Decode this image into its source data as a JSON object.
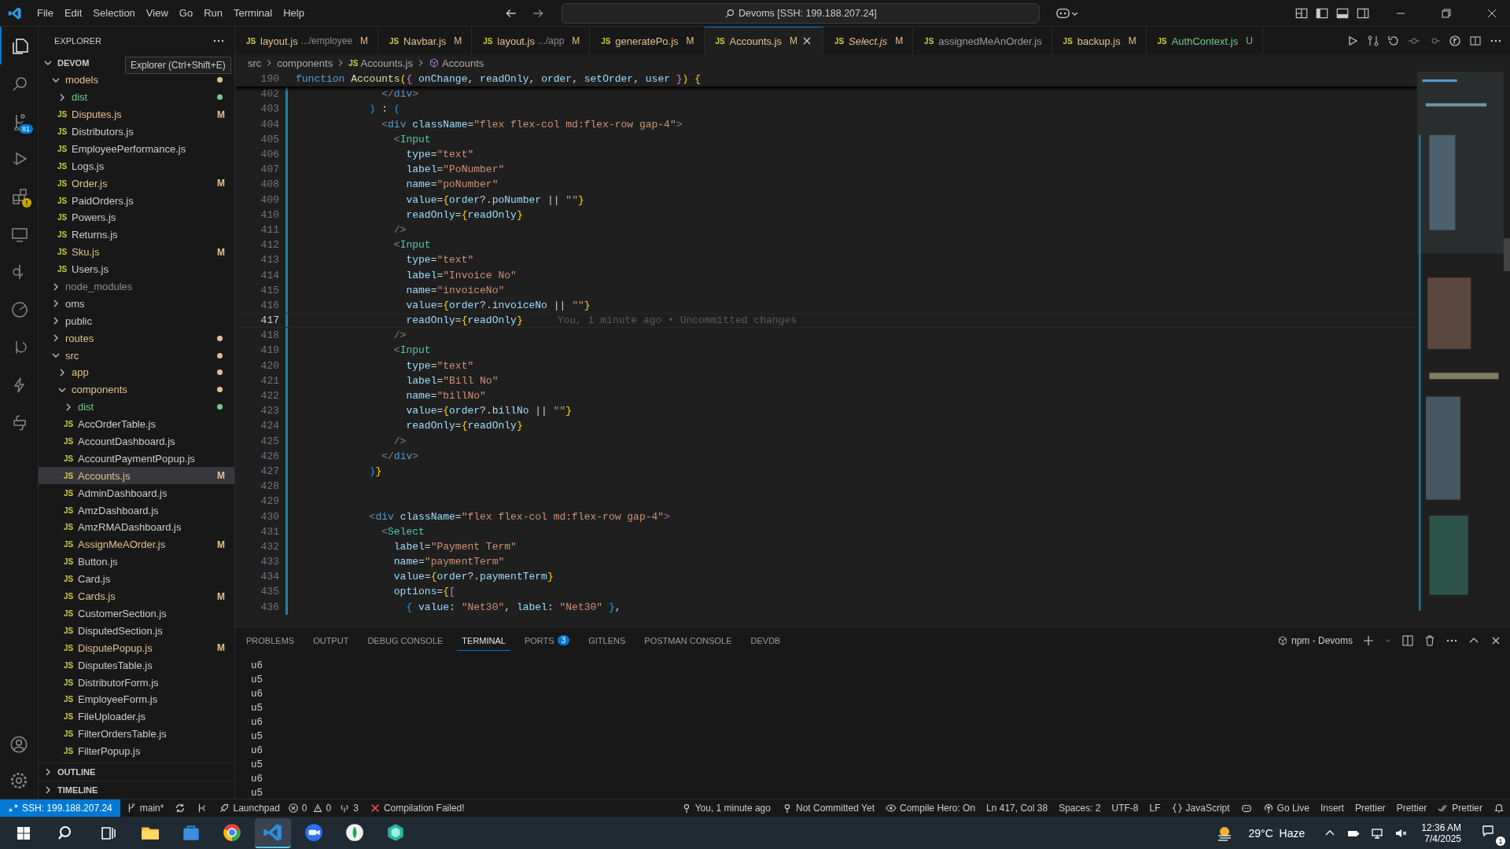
{
  "title_bar": {
    "menu": [
      "File",
      "Edit",
      "Selection",
      "View",
      "Go",
      "Run",
      "Terminal",
      "Help"
    ],
    "command_center": "Devoms [SSH: 199.188.207.24]"
  },
  "activity_bar": {
    "items": [
      {
        "selected": true
      },
      {
        "selected": false
      },
      {
        "selected": false,
        "badge": "81"
      },
      {
        "selected": false
      },
      {
        "selected": false,
        "warning": true
      },
      {
        "selected": false
      },
      {
        "selected": false
      },
      {
        "selected": false
      },
      {
        "selected": false
      },
      {
        "selected": false
      },
      {
        "selected": false
      }
    ]
  },
  "explorer": {
    "title": "EXPLORER",
    "tooltip": "Explorer (Ctrl+Shift+E)",
    "root": {
      "label": "DEVOM",
      "expanded": true,
      "children": [
        {
          "kind": "folder",
          "label": "models",
          "expanded": true,
          "color": "#e2c08d",
          "selected": false,
          "children": [
            {
              "kind": "folder",
              "label": "dist",
              "expanded": false,
              "color": "#73c991",
              "selected": false
            },
            {
              "kind": "file",
              "icon": "JS",
              "label": "Disputes.js",
              "status": "M",
              "selected": false
            },
            {
              "kind": "file",
              "icon": "JS",
              "label": "Distributors.js",
              "selected": false
            },
            {
              "kind": "file",
              "icon": "JS",
              "label": "EmployeePerformance.js",
              "selected": false
            },
            {
              "kind": "file",
              "icon": "JS",
              "label": "Logs.js",
              "selected": false
            },
            {
              "kind": "file",
              "icon": "JS",
              "label": "Order.js",
              "status": "M",
              "selected": false
            },
            {
              "kind": "file",
              "icon": "JS",
              "label": "PaidOrders.js",
              "selected": false
            },
            {
              "kind": "file",
              "icon": "JS",
              "label": "Powers.js",
              "selected": false
            },
            {
              "kind": "file",
              "icon": "JS",
              "label": "Returns.js",
              "selected": false
            },
            {
              "kind": "file",
              "icon": "JS",
              "label": "Sku.js",
              "status": "M",
              "selected": false
            },
            {
              "kind": "file",
              "icon": "JS",
              "label": "Users.js",
              "selected": false
            }
          ]
        },
        {
          "kind": "folder",
          "label": "node_modules",
          "expanded": false,
          "dimmed": true,
          "selected": false
        },
        {
          "kind": "folder",
          "label": "oms",
          "expanded": false,
          "selected": false
        },
        {
          "kind": "folder",
          "label": "public",
          "expanded": false,
          "selected": false
        },
        {
          "kind": "folder",
          "label": "routes",
          "expanded": false,
          "color": "#e2c08d",
          "selected": false
        },
        {
          "kind": "folder",
          "label": "src",
          "expanded": true,
          "color": "#e2c08d",
          "selected": false,
          "children": [
            {
              "kind": "folder",
              "label": "app",
              "expanded": false,
              "color": "#e2c08d",
              "selected": false
            },
            {
              "kind": "folder",
              "label": "components",
              "expanded": true,
              "color": "#e2c08d",
              "selected": false,
              "children": [
                {
                  "kind": "folder",
                  "label": "dist",
                  "expanded": false,
                  "color": "#73c991",
                  "selected": false
                },
                {
                  "kind": "file",
                  "icon": "JS",
                  "label": "AccOrderTable.js",
                  "selected": false
                },
                {
                  "kind": "file",
                  "icon": "JS",
                  "label": "AccountDashboard.js",
                  "selected": false
                },
                {
                  "kind": "file",
                  "icon": "JS",
                  "label": "AccountPaymentPopup.js",
                  "selected": false
                },
                {
                  "kind": "file",
                  "icon": "JS",
                  "label": "Accounts.js",
                  "status": "M",
                  "selected": true
                },
                {
                  "kind": "file",
                  "icon": "JS",
                  "label": "AdminDashboard.js",
                  "selected": false
                },
                {
                  "kind": "file",
                  "icon": "JS",
                  "label": "AmzDashboard.js",
                  "selected": false
                },
                {
                  "kind": "file",
                  "icon": "JS",
                  "label": "AmzRMADashboard.js",
                  "selected": false
                },
                {
                  "kind": "file",
                  "icon": "JS",
                  "label": "AssignMeAOrder.js",
                  "status": "M",
                  "selected": false
                },
                {
                  "kind": "file",
                  "icon": "JS",
                  "label": "Button.js",
                  "selected": false
                },
                {
                  "kind": "file",
                  "icon": "JS",
                  "label": "Card.js",
                  "selected": false
                },
                {
                  "kind": "file",
                  "icon": "JS",
                  "label": "Cards.js",
                  "status": "M",
                  "selected": false
                },
                {
                  "kind": "file",
                  "icon": "JS",
                  "label": "CustomerSection.js",
                  "selected": false
                },
                {
                  "kind": "file",
                  "icon": "JS",
                  "label": "DisputedSection.js",
                  "selected": false
                },
                {
                  "kind": "file",
                  "icon": "JS",
                  "label": "DisputePopup.js",
                  "status": "M",
                  "selected": false
                },
                {
                  "kind": "file",
                  "icon": "JS",
                  "label": "DisputesTable.js",
                  "selected": false
                },
                {
                  "kind": "file",
                  "icon": "JS",
                  "label": "DistributorForm.js",
                  "selected": false
                },
                {
                  "kind": "file",
                  "icon": "JS",
                  "label": "EmployeeForm.js",
                  "selected": false
                },
                {
                  "kind": "file",
                  "icon": "JS",
                  "label": "FileUploader.js",
                  "selected": false
                },
                {
                  "kind": "file",
                  "icon": "JS",
                  "label": "FilterOrdersTable.js",
                  "selected": false
                },
                {
                  "kind": "file",
                  "icon": "JS",
                  "label": "FilterPopup.js",
                  "selected": false
                }
              ]
            }
          ]
        }
      ]
    },
    "sections": [
      {
        "label": "OUTLINE",
        "expanded": false
      },
      {
        "label": "TIMELINE",
        "expanded": false
      }
    ]
  },
  "tabs": [
    {
      "icon": "JS",
      "label": "layout.js",
      "description": ".../employee",
      "status": "M",
      "selected": false,
      "preview": false
    },
    {
      "icon": "JS",
      "label": "Navbar.js",
      "status": "M",
      "selected": false,
      "preview": false
    },
    {
      "icon": "JS",
      "label": "layout.js",
      "description": ".../app",
      "status": "M",
      "selected": false,
      "preview": false
    },
    {
      "icon": "JS",
      "label": "generatePo.js",
      "status": "M",
      "selected": false,
      "preview": false
    },
    {
      "icon": "JS",
      "label": "Accounts.js",
      "status": "M",
      "selected": true,
      "preview": false
    },
    {
      "icon": "JS",
      "label": "Select.js",
      "status": "M",
      "selected": false,
      "preview": true
    },
    {
      "icon": "JS",
      "label": "assignedMeAnOrder.js",
      "selected": false,
      "preview": false
    },
    {
      "icon": "JS",
      "label": "backup.js",
      "status": "M",
      "selected": false,
      "preview": false
    },
    {
      "icon": "JS",
      "label": "AuthContext.js",
      "status": "U",
      "selected": false,
      "preview": false
    }
  ],
  "breadcrumbs": [
    {
      "label": "src"
    },
    {
      "label": "components"
    },
    {
      "icon": "JS",
      "label": "Accounts.js"
    },
    {
      "label": "Accounts",
      "symbol": true
    }
  ],
  "sticky_line": {
    "number": "190",
    "tokens": [
      {
        "kind": "keyword",
        "text": "function "
      },
      {
        "kind": "function",
        "text": "Accounts"
      },
      {
        "kind": "bracket1",
        "text": "("
      },
      {
        "kind": "bracket2",
        "text": "{ "
      },
      {
        "kind": "variable",
        "text": "onChange"
      },
      {
        "kind": "plain",
        "text": ", "
      },
      {
        "kind": "variable",
        "text": "readOnly"
      },
      {
        "kind": "plain",
        "text": ", "
      },
      {
        "kind": "variable",
        "text": "order"
      },
      {
        "kind": "plain",
        "text": ", "
      },
      {
        "kind": "variable",
        "text": "setOrder"
      },
      {
        "kind": "plain",
        "text": ", "
      },
      {
        "kind": "variable",
        "text": "user"
      },
      {
        "kind": "bracket2",
        "text": " }"
      },
      {
        "kind": "bracket1",
        "text": ")"
      },
      {
        "kind": "bracket1",
        "text": " {"
      }
    ]
  },
  "code_lines": [
    {
      "number": "402",
      "current": false,
      "tokens": [
        {
          "kind": "punct",
          "text": "              </"
        },
        {
          "kind": "keyword",
          "text": "div"
        },
        {
          "kind": "punct",
          "text": ">"
        }
      ]
    },
    {
      "number": "403",
      "current": false,
      "tokens": [
        {
          "kind": "bracket3",
          "text": "            )"
        },
        {
          "kind": "plain",
          "text": " : "
        },
        {
          "kind": "bracket3",
          "text": "("
        }
      ]
    },
    {
      "number": "404",
      "current": false,
      "tokens": [
        {
          "kind": "punct",
          "text": "              <"
        },
        {
          "kind": "keyword",
          "text": "div"
        },
        {
          "kind": "variable",
          "text": " className"
        },
        {
          "kind": "plain",
          "text": "="
        },
        {
          "kind": "string",
          "text": "\"flex flex-col md:flex-row gap-4\""
        },
        {
          "kind": "punct",
          "text": ">"
        }
      ]
    },
    {
      "number": "405",
      "current": false,
      "tokens": [
        {
          "kind": "punct",
          "text": "                <"
        },
        {
          "kind": "component",
          "text": "Input"
        }
      ]
    },
    {
      "number": "406",
      "current": false,
      "tokens": [
        {
          "kind": "variable",
          "text": "                  type"
        },
        {
          "kind": "plain",
          "text": "="
        },
        {
          "kind": "string",
          "text": "\"text\""
        }
      ]
    },
    {
      "number": "407",
      "current": false,
      "tokens": [
        {
          "kind": "variable",
          "text": "                  label"
        },
        {
          "kind": "plain",
          "text": "="
        },
        {
          "kind": "string",
          "text": "\"PoNumber\""
        }
      ]
    },
    {
      "number": "408",
      "current": false,
      "tokens": [
        {
          "kind": "variable",
          "text": "                  name"
        },
        {
          "kind": "plain",
          "text": "="
        },
        {
          "kind": "string",
          "text": "\"poNumber\""
        }
      ]
    },
    {
      "number": "409",
      "current": false,
      "tokens": [
        {
          "kind": "variable",
          "text": "                  value"
        },
        {
          "kind": "plain",
          "text": "="
        },
        {
          "kind": "bracket1",
          "text": "{"
        },
        {
          "kind": "variable",
          "text": "order"
        },
        {
          "kind": "plain",
          "text": "?."
        },
        {
          "kind": "variable",
          "text": "poNumber"
        },
        {
          "kind": "plain",
          "text": " || "
        },
        {
          "kind": "string",
          "text": "\"\""
        },
        {
          "kind": "bracket1",
          "text": "}"
        }
      ]
    },
    {
      "number": "410",
      "current": false,
      "tokens": [
        {
          "kind": "variable",
          "text": "                  readOnly"
        },
        {
          "kind": "plain",
          "text": "="
        },
        {
          "kind": "bracket1",
          "text": "{"
        },
        {
          "kind": "variable",
          "text": "readOnly"
        },
        {
          "kind": "bracket1",
          "text": "}"
        }
      ]
    },
    {
      "number": "411",
      "current": false,
      "tokens": [
        {
          "kind": "punct",
          "text": "                />"
        }
      ]
    },
    {
      "number": "412",
      "current": false,
      "tokens": [
        {
          "kind": "punct",
          "text": "                <"
        },
        {
          "kind": "component",
          "text": "Input"
        }
      ]
    },
    {
      "number": "413",
      "current": false,
      "tokens": [
        {
          "kind": "variable",
          "text": "                  type"
        },
        {
          "kind": "plain",
          "text": "="
        },
        {
          "kind": "string",
          "text": "\"text\""
        }
      ]
    },
    {
      "number": "414",
      "current": false,
      "tokens": [
        {
          "kind": "variable",
          "text": "                  label"
        },
        {
          "kind": "plain",
          "text": "="
        },
        {
          "kind": "string",
          "text": "\"Invoice No\""
        }
      ]
    },
    {
      "number": "415",
      "current": false,
      "tokens": [
        {
          "kind": "variable",
          "text": "                  name"
        },
        {
          "kind": "plain",
          "text": "="
        },
        {
          "kind": "string",
          "text": "\"invoiceNo\""
        }
      ]
    },
    {
      "number": "416",
      "current": false,
      "tokens": [
        {
          "kind": "variable",
          "text": "                  value"
        },
        {
          "kind": "plain",
          "text": "="
        },
        {
          "kind": "bracket1",
          "text": "{"
        },
        {
          "kind": "variable",
          "text": "order"
        },
        {
          "kind": "plain",
          "text": "?."
        },
        {
          "kind": "variable",
          "text": "invoiceNo"
        },
        {
          "kind": "plain",
          "text": " || "
        },
        {
          "kind": "string",
          "text": "\"\""
        },
        {
          "kind": "bracket1",
          "text": "}"
        }
      ]
    },
    {
      "number": "417",
      "current": true,
      "blame": "You, 1 minute ago • Uncommitted changes",
      "tokens": [
        {
          "kind": "variable",
          "text": "                  readOnly"
        },
        {
          "kind": "plain",
          "text": "="
        },
        {
          "kind": "bracket1",
          "text": "{"
        },
        {
          "kind": "variable",
          "text": "readOnly"
        },
        {
          "kind": "bracket1",
          "text": "}"
        }
      ]
    },
    {
      "number": "418",
      "current": false,
      "tokens": [
        {
          "kind": "punct",
          "text": "                />"
        }
      ]
    },
    {
      "number": "419",
      "current": false,
      "tokens": [
        {
          "kind": "punct",
          "text": "                <"
        },
        {
          "kind": "component",
          "text": "Input"
        }
      ]
    },
    {
      "number": "420",
      "current": false,
      "tokens": [
        {
          "kind": "variable",
          "text": "                  type"
        },
        {
          "kind": "plain",
          "text": "="
        },
        {
          "kind": "string",
          "text": "\"text\""
        }
      ]
    },
    {
      "number": "421",
      "current": false,
      "tokens": [
        {
          "kind": "variable",
          "text": "                  label"
        },
        {
          "kind": "plain",
          "text": "="
        },
        {
          "kind": "string",
          "text": "\"Bill No\""
        }
      ]
    },
    {
      "number": "422",
      "current": false,
      "tokens": [
        {
          "kind": "variable",
          "text": "                  name"
        },
        {
          "kind": "plain",
          "text": "="
        },
        {
          "kind": "string",
          "text": "\"billNo\""
        }
      ]
    },
    {
      "number": "423",
      "current": false,
      "tokens": [
        {
          "kind": "variable",
          "text": "                  value"
        },
        {
          "kind": "plain",
          "text": "="
        },
        {
          "kind": "bracket1",
          "text": "{"
        },
        {
          "kind": "variable",
          "text": "order"
        },
        {
          "kind": "plain",
          "text": "?."
        },
        {
          "kind": "variable",
          "text": "billNo"
        },
        {
          "kind": "plain",
          "text": " || "
        },
        {
          "kind": "string",
          "text": "\"\""
        },
        {
          "kind": "bracket1",
          "text": "}"
        }
      ]
    },
    {
      "number": "424",
      "current": false,
      "tokens": [
        {
          "kind": "variable",
          "text": "                  readOnly"
        },
        {
          "kind": "plain",
          "text": "="
        },
        {
          "kind": "bracket1",
          "text": "{"
        },
        {
          "kind": "variable",
          "text": "readOnly"
        },
        {
          "kind": "bracket1",
          "text": "}"
        }
      ]
    },
    {
      "number": "425",
      "current": false,
      "tokens": [
        {
          "kind": "punct",
          "text": "                />"
        }
      ]
    },
    {
      "number": "426",
      "current": false,
      "tokens": [
        {
          "kind": "punct",
          "text": "              </"
        },
        {
          "kind": "keyword",
          "text": "div"
        },
        {
          "kind": "punct",
          "text": ">"
        }
      ]
    },
    {
      "number": "427",
      "current": false,
      "tokens": [
        {
          "kind": "bracket3",
          "text": "            )"
        },
        {
          "kind": "bracket1",
          "text": "}"
        }
      ]
    },
    {
      "number": "428",
      "current": false
    },
    {
      "number": "429",
      "current": false
    },
    {
      "number": "430",
      "current": false,
      "tokens": [
        {
          "kind": "punct",
          "text": "            <"
        },
        {
          "kind": "keyword",
          "text": "div"
        },
        {
          "kind": "variable",
          "text": " className"
        },
        {
          "kind": "plain",
          "text": "="
        },
        {
          "kind": "string",
          "text": "\"flex flex-col md:flex-row gap-4\""
        },
        {
          "kind": "punct",
          "text": ">"
        }
      ]
    },
    {
      "number": "431",
      "current": false,
      "tokens": [
        {
          "kind": "punct",
          "text": "              <"
        },
        {
          "kind": "component",
          "text": "Select"
        }
      ]
    },
    {
      "number": "432",
      "current": false,
      "tokens": [
        {
          "kind": "variable",
          "text": "                label"
        },
        {
          "kind": "plain",
          "text": "="
        },
        {
          "kind": "string",
          "text": "\"Payment Term\""
        }
      ]
    },
    {
      "number": "433",
      "current": false,
      "tokens": [
        {
          "kind": "variable",
          "text": "                name"
        },
        {
          "kind": "plain",
          "text": "="
        },
        {
          "kind": "string",
          "text": "\"paymentTerm\""
        }
      ]
    },
    {
      "number": "434",
      "current": false,
      "tokens": [
        {
          "kind": "variable",
          "text": "                value"
        },
        {
          "kind": "plain",
          "text": "="
        },
        {
          "kind": "bracket1",
          "text": "{"
        },
        {
          "kind": "variable",
          "text": "order"
        },
        {
          "kind": "plain",
          "text": "?."
        },
        {
          "kind": "variable",
          "text": "paymentTerm"
        },
        {
          "kind": "bracket1",
          "text": "}"
        }
      ]
    },
    {
      "number": "435",
      "current": false,
      "tokens": [
        {
          "kind": "variable",
          "text": "                options"
        },
        {
          "kind": "plain",
          "text": "="
        },
        {
          "kind": "bracket1",
          "text": "{"
        },
        {
          "kind": "bracket2",
          "text": "["
        }
      ]
    },
    {
      "number": "436",
      "current": false,
      "tokens": [
        {
          "kind": "bracket3",
          "text": "                  { "
        },
        {
          "kind": "variable",
          "text": "value"
        },
        {
          "kind": "plain",
          "text": ": "
        },
        {
          "kind": "string",
          "text": "\"Net30\""
        },
        {
          "kind": "plain",
          "text": ", "
        },
        {
          "kind": "variable",
          "text": "label"
        },
        {
          "kind": "plain",
          "text": ": "
        },
        {
          "kind": "string",
          "text": "\"Net30\""
        },
        {
          "kind": "bracket3",
          "text": " }"
        },
        {
          "kind": "plain",
          "text": ","
        }
      ]
    }
  ],
  "panel": {
    "tabs": [
      {
        "label": "PROBLEMS",
        "selected": false
      },
      {
        "label": "OUTPUT",
        "selected": false
      },
      {
        "label": "DEBUG CONSOLE",
        "selected": false
      },
      {
        "label": "TERMINAL",
        "selected": true
      },
      {
        "label": "PORTS",
        "badge": "3",
        "selected": false
      },
      {
        "label": "GITLENS",
        "selected": false
      },
      {
        "label": "POSTMAN CONSOLE",
        "selected": false
      },
      {
        "label": "DEVDB",
        "selected": false
      }
    ],
    "terminal_name": "npm - Devoms",
    "terminal_lines": [
      "u6",
      "u5",
      "u6",
      "u5",
      "u6",
      "u5",
      "u6",
      "u5",
      "u6",
      "u5"
    ]
  },
  "status_bar": {
    "left": [
      {
        "kind": "remote",
        "text": "SSH: 199.188.207.24"
      },
      {
        "kind": "branch",
        "text": "main*"
      },
      {
        "kind": "sync"
      },
      {
        "kind": "graph"
      },
      {
        "kind": "launchpad",
        "text": "Launchpad"
      },
      {
        "kind": "problems",
        "errors": "0",
        "warnings": "0"
      },
      {
        "kind": "ports",
        "text": "3"
      },
      {
        "kind": "error",
        "text": "Compilation Failed!"
      }
    ],
    "right": [
      {
        "kind": "blame",
        "text": "You, 1 minute ago"
      },
      {
        "kind": "commit",
        "text": "Not Committed Yet"
      },
      {
        "kind": "eye",
        "text": "Compile Hero: On"
      },
      {
        "kind": "text",
        "text": "Ln 417, Col 38"
      },
      {
        "kind": "text",
        "text": "Spaces: 2"
      },
      {
        "kind": "text",
        "text": "UTF-8"
      },
      {
        "kind": "text",
        "text": "LF"
      },
      {
        "kind": "language",
        "text": "JavaScript"
      },
      {
        "kind": "copilot"
      },
      {
        "kind": "live",
        "text": "Go Live"
      },
      {
        "kind": "text",
        "text": "Insert"
      },
      {
        "kind": "text",
        "text": "Prettier"
      },
      {
        "kind": "text",
        "text": "Prettier"
      },
      {
        "kind": "check",
        "text": "Prettier"
      },
      {
        "kind": "bell"
      }
    ]
  },
  "taskbar": {
    "apps": [
      {
        "selected": false
      },
      {
        "selected": false
      },
      {
        "selected": false
      },
      {
        "selected": true
      },
      {
        "selected": false
      },
      {
        "selected": false
      },
      {
        "selected": false
      }
    ],
    "weather": "29°C  Haze",
    "time": "12:36 AM",
    "date": "7/4/2025",
    "notifications": "1"
  }
}
